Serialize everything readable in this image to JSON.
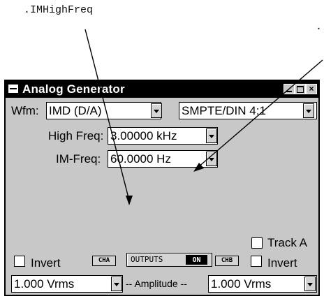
{
  "callout": {
    "label": ".IMHighFreq",
    "label_right": "."
  },
  "window": {
    "title": "Analog Generator",
    "buttons": {
      "minimize": "-",
      "maximize": "□",
      "close": "×"
    }
  },
  "waveform": {
    "label": "Wfm:",
    "type_value": "IMD (D/A)",
    "standard_value": "SMPTE/DIN 4:1"
  },
  "high_freq": {
    "label": "High Freq:",
    "value": "3.00000 kHz"
  },
  "im_freq": {
    "label": "IM-Freq:",
    "value": "60.0000  Hz"
  },
  "channel_a": {
    "invert_label": "Invert",
    "tag": "CHA",
    "amplitude_value": "1.000  Vrms"
  },
  "outputs": {
    "label": "OUTPUTS",
    "state": "ON"
  },
  "channel_b": {
    "track_label": "Track A",
    "invert_label": "Invert",
    "tag": "CHB",
    "amplitude_value": "1.000  Vrms"
  },
  "amplitude": {
    "label": "-- Amplitude --"
  }
}
